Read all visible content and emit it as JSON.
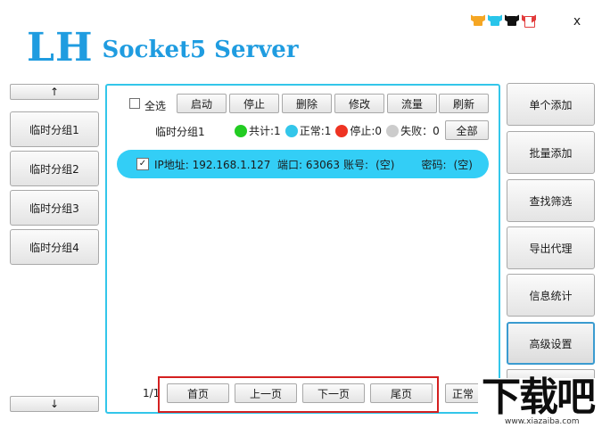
{
  "app": {
    "title_main": "LH",
    "title_sub": "Socket5 Server",
    "close": "x"
  },
  "skins": [
    {
      "icon": "shirt-orange-icon",
      "color": "#f5a623"
    },
    {
      "icon": "shirt-cyan-icon",
      "color": "#29c5ea"
    },
    {
      "icon": "shirt-black-icon",
      "color": "#111111"
    },
    {
      "icon": "shirt-white-red-icon",
      "color": "#e23b3b"
    }
  ],
  "left": {
    "up": "↑",
    "down": "↓",
    "groups": [
      "临时分组1",
      "临时分组2",
      "临时分组3",
      "临时分组4"
    ]
  },
  "toolbar": {
    "select_all": "全选",
    "buttons": [
      "启动",
      "停止",
      "删除",
      "修改",
      "流量",
      "刷新"
    ]
  },
  "group": {
    "name": "临时分组1",
    "total": "共计:1",
    "normal": "正常:1",
    "stopped": "停止:0",
    "failed": "失败：0",
    "all_button": "全部",
    "colors": {
      "total": "#22cc22",
      "normal": "#33c6ea",
      "stopped": "#ee3322",
      "failed": "#cccccc"
    }
  },
  "proxy_rows": [
    {
      "checked": true,
      "ip": "IP地址: 192.168.1.127",
      "port": "端口: 63063",
      "account": "账号:",
      "account_value": "(空)",
      "password": "密码:",
      "password_value": "(空)"
    }
  ],
  "pagination": {
    "page": "1/1",
    "first": "首页",
    "prev": "上一页",
    "next": "下一页",
    "last": "尾页",
    "status": "正常"
  },
  "right": {
    "buttons": [
      "单个添加",
      "批量添加",
      "查找筛选",
      "导出代理",
      "信息统计",
      "高级设置"
    ]
  },
  "watermark": {
    "text": "下载吧",
    "url": "www.xiazaiba.com"
  }
}
